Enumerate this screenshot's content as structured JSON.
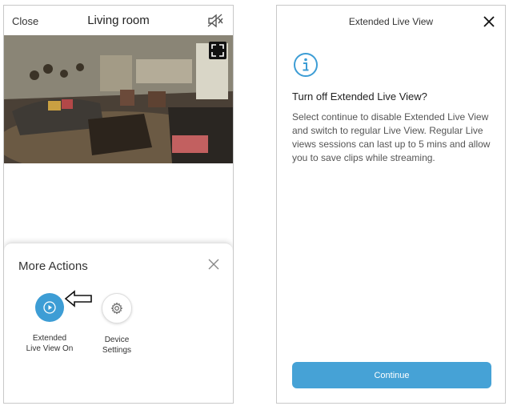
{
  "left_screen": {
    "header": {
      "close_label": "Close",
      "title": "Living room",
      "mute_icon": "speaker-muted-icon",
      "fullscreen_icon": "fullscreen-icon"
    },
    "sheet": {
      "title": "More Actions",
      "close_icon": "close-icon",
      "actions": [
        {
          "label": "Extended\nLive View On",
          "icon": "play-circle-icon",
          "color": "#3d9dd5"
        },
        {
          "label": "Device\nSettings",
          "icon": "gear-icon",
          "color": "#ffffff"
        }
      ],
      "pointer_icon": "left-arrow-icon"
    }
  },
  "right_screen": {
    "title": "Extended Live View",
    "close_icon": "close-icon",
    "info_icon": "info-icon",
    "heading": "Turn off Extended Live View?",
    "body": "Select continue to disable Extended Live View and switch to regular Live View. Regular Live views sessions can last up to 5 mins and allow you to save clips while streaming.",
    "continue_label": "Continue",
    "accent_color": "#46a2d6"
  }
}
